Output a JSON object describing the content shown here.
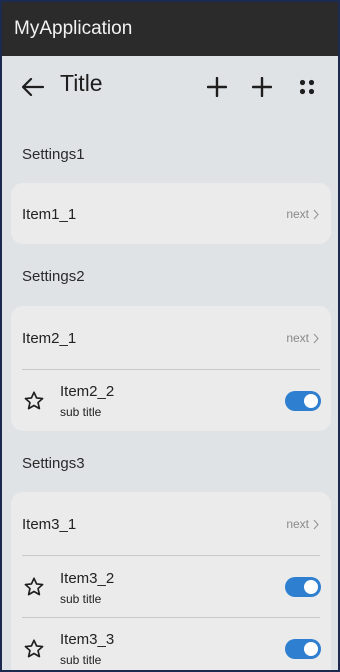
{
  "app": {
    "title": "MyApplication"
  },
  "header": {
    "title": "Title"
  },
  "sections": [
    {
      "title": "Settings1",
      "items": [
        {
          "label": "Item1_1",
          "next": "next"
        }
      ]
    },
    {
      "title": "Settings2",
      "items": [
        {
          "label": "Item2_1",
          "next": "next"
        },
        {
          "label": "Item2_2",
          "subtitle": "sub title",
          "toggle": true
        }
      ]
    },
    {
      "title": "Settings3",
      "items": [
        {
          "label": "Item3_1",
          "next": "next"
        },
        {
          "label": "Item3_2",
          "subtitle": "sub title",
          "toggle": true
        },
        {
          "label": "Item3_3",
          "subtitle": "sub title",
          "toggle": true
        }
      ]
    }
  ],
  "colors": {
    "toggle_on": "#2f7fd1",
    "appbar": "#2b2b2b",
    "background": "#dfe3e6",
    "card": "#ebebeb"
  },
  "icons": [
    "back-arrow-icon",
    "plus-icon",
    "plus-icon",
    "more-grid-icon",
    "chevron-right-icon",
    "star-icon"
  ]
}
